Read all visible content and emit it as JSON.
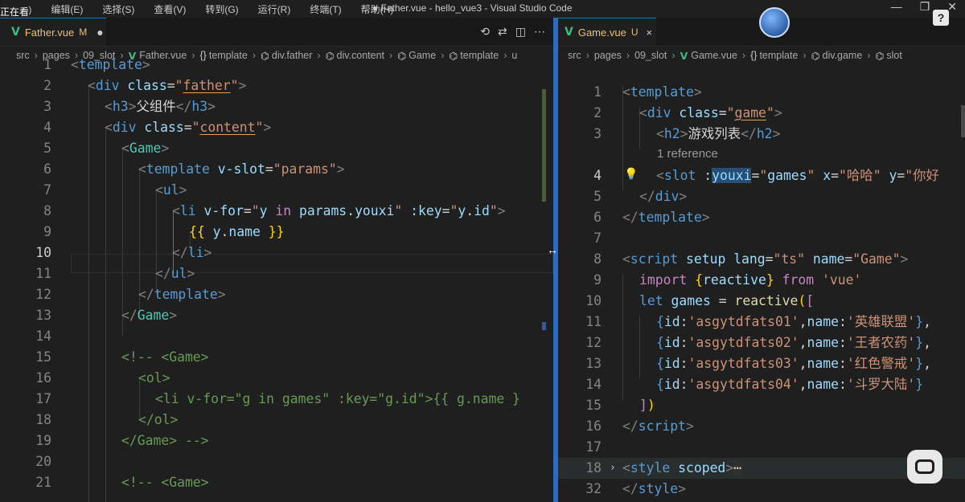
{
  "titlebar": {
    "menu": [
      "文件(F)",
      "编辑(E)",
      "选择(S)",
      "查看(V)",
      "转到(G)",
      "运行(R)",
      "终端(T)",
      "帮助(H)"
    ],
    "overlay": "正在看",
    "window_title": "● Father.vue - hello_vue3 - Visual Studio Code",
    "help": "?"
  },
  "left": {
    "tab": {
      "name": "Father.vue",
      "badge": "M",
      "dot": "●"
    },
    "breadcrumb": [
      "src",
      "pages",
      "09_slot",
      "Father.vue",
      "template",
      "div.father",
      "div.content",
      "Game",
      "template",
      "u"
    ],
    "line_numbers": [
      "1",
      "2",
      "3",
      "4",
      "5",
      "6",
      "7",
      "8",
      "9",
      "10",
      "11",
      "12",
      "13",
      "14",
      "15",
      "16",
      "17",
      "18",
      "19",
      "20",
      "21"
    ],
    "current_line": "10"
  },
  "right": {
    "tab": {
      "name": "Game.vue",
      "badge": "U",
      "close": "×"
    },
    "breadcrumb": [
      "src",
      "pages",
      "09_slot",
      "Game.vue",
      "template",
      "div.game",
      "slot"
    ],
    "line_numbers": [
      "1",
      "2",
      "3",
      "4",
      "5",
      "6",
      "7",
      "8",
      "9",
      "10",
      "11",
      "12",
      "13",
      "14",
      "15",
      "16",
      "17",
      "18",
      "32"
    ],
    "codelens": "1 reference",
    "current_line": "4"
  },
  "colors": {
    "sash": "#2b6cc4",
    "accent": "#0078d4",
    "vue": "#41b883"
  }
}
